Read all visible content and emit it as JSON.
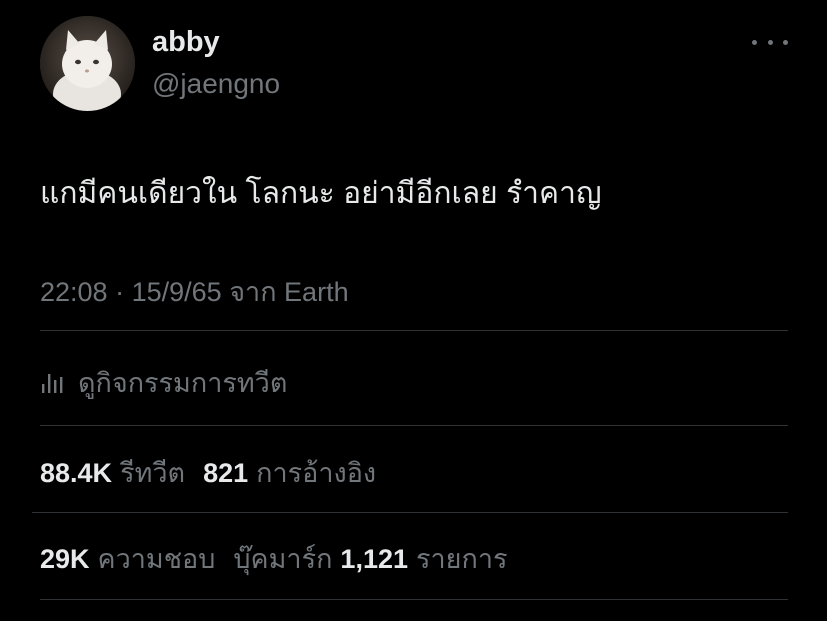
{
  "user": {
    "display_name": "abby",
    "handle": "@jaengno",
    "avatar_icon": "white-cat-avatar"
  },
  "tweet": {
    "text": "แกมีคนเดียวใน โลกนะ อย่ามีอีกเลย รำคาญ",
    "time": "22:08",
    "separator": "·",
    "date": "15/9/65",
    "source": "จาก Earth"
  },
  "activity": {
    "label": "ดูกิจกรรมการทวีต",
    "icon": "analytics-bars-icon"
  },
  "stats": {
    "retweets": {
      "count": "88.4K",
      "label": "รีทวีต"
    },
    "quotes": {
      "count": "821",
      "label": "การอ้างอิง"
    },
    "likes": {
      "count": "29K",
      "label": "ความชอบ"
    },
    "bookmarks_label": "บุ๊คมาร์ก",
    "bookmarks": {
      "count": "1,121",
      "label": "รายการ"
    }
  },
  "colors": {
    "background": "#000000",
    "primary_text": "#e7e9ea",
    "secondary_text": "#71767b",
    "divider": "#2f3336"
  }
}
